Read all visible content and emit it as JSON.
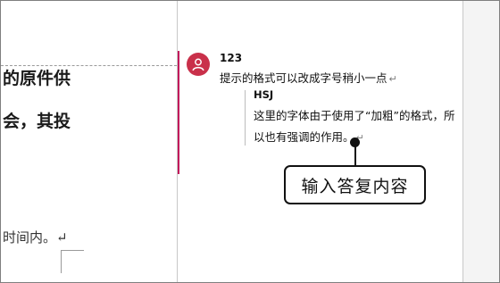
{
  "document": {
    "line1": "的原件供",
    "line2": "会，其投",
    "line3": "时间内。↵"
  },
  "comment": {
    "author": "123",
    "text": "提示的格式可以改成字号稍小一点",
    "para_mark": "↵",
    "avatar_icon": "user-icon",
    "accent_color": "#c2185b",
    "avatar_color": "#c9304a"
  },
  "reply": {
    "author": "HSJ",
    "text": "这里的字体由于使用了“加粗”的格式，所以也有强调的作用。",
    "para_mark": "↵"
  },
  "annotation": {
    "callout_text": "输入答复内容"
  }
}
